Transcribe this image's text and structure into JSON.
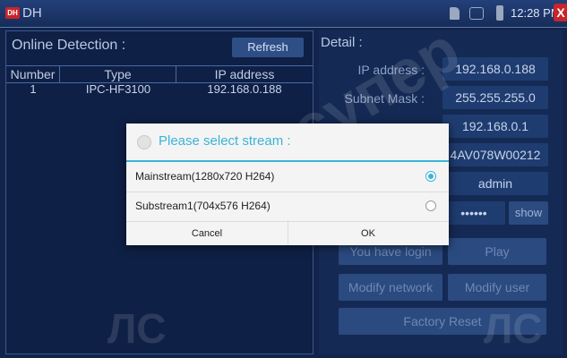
{
  "app": {
    "logo": "DH",
    "title": "DH",
    "time": "12:28 PM",
    "close_label": "X",
    "icons": [
      "sd-card-icon",
      "network-icon",
      "battery-icon"
    ]
  },
  "left": {
    "title": "Online Detection :",
    "refresh_label": "Refresh",
    "columns": [
      "Number",
      "Type",
      "IP address"
    ],
    "rows": [
      {
        "number": "1",
        "type": "IPC-HF3100",
        "ip": "192.168.0.188"
      }
    ]
  },
  "right": {
    "title": "Detail :",
    "fields": [
      {
        "label": "IP address :",
        "value": "192.168.0.188"
      },
      {
        "label": "Subnet Mask :",
        "value": "255.255.255.0"
      },
      {
        "label": "",
        "value": "192.168.0.1"
      },
      {
        "label": "",
        "value": "4AV078W00212"
      },
      {
        "label": "",
        "value": "admin"
      },
      {
        "label": "",
        "value": "••••••"
      }
    ],
    "show_label": "show",
    "login_status": "You have login",
    "play_label": "Play",
    "modify_network_label": "Modify network",
    "modify_user_label": "Modify user",
    "factory_reset_label": "Factory Reset"
  },
  "dialog": {
    "title": "Please select stream :",
    "options": [
      {
        "label": "Mainstream(1280x720 H264)",
        "selected": true
      },
      {
        "label": "Substream1(704x576 H264)",
        "selected": false
      }
    ],
    "cancel_label": "Cancel",
    "ok_label": "OK"
  },
  "watermark": {
    "brand": "cупер",
    "letters": "ЛС"
  },
  "colors": {
    "accent": "#3ab4d6",
    "background": "#12244a",
    "close": "#c8242b"
  }
}
